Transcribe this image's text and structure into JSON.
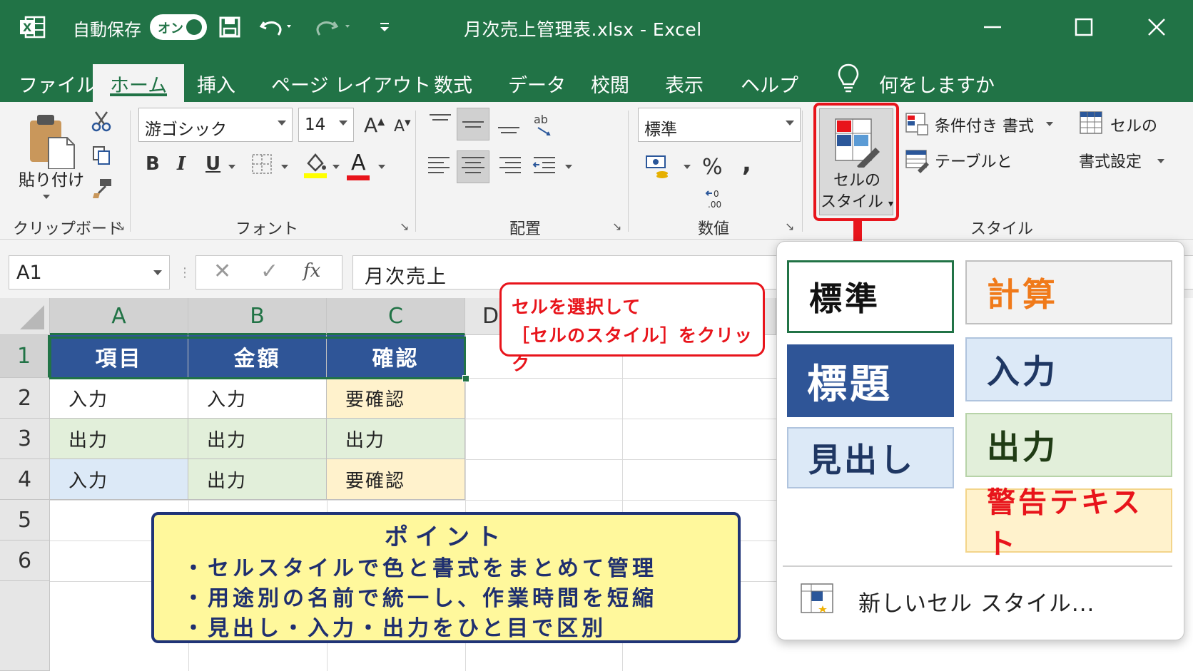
{
  "titlebar": {
    "autosave_label": "自動保存",
    "autosave_state": "オン",
    "doc_title": "月次売上管理表.xlsx  -  Excel",
    "bg_color": "#217346"
  },
  "tabs": {
    "items": [
      "ファイル",
      "ホーム",
      "挿入",
      "ページ レイアウト",
      "数式",
      "データ",
      "校閲",
      "表示",
      "ヘルプ"
    ],
    "active": "ホーム",
    "tell_me": "何をしますか"
  },
  "ribbon": {
    "clipboard": {
      "paste_label": "貼り付け",
      "group_label": "クリップボード"
    },
    "font": {
      "font_name": "游ゴシック",
      "font_size": "14",
      "grow": "A",
      "shrink": "A",
      "bold": "B",
      "italic": "I",
      "underline": "U",
      "font_color_glyph": "A",
      "group_label": "フォント"
    },
    "alignment": {
      "group_label": "配置"
    },
    "number": {
      "format": "標準",
      "percent": "%",
      "comma": ",",
      "group_label": "数値"
    },
    "styles": {
      "conditional": "条件付き 書式",
      "table": "テーブルと",
      "cell_format_1": "セルの",
      "cell_format_2": "書式設定",
      "cell_styles_1": "セルの",
      "cell_styles_2": "スタイル",
      "group_label": "スタイル"
    }
  },
  "formula_bar": {
    "name_box": "A1",
    "fx": "fx",
    "formula": "月次売上"
  },
  "sheet": {
    "columns": [
      "A",
      "B",
      "C",
      "D"
    ],
    "rows": [
      "1",
      "2",
      "3",
      "4",
      "5",
      "6"
    ],
    "header_row": [
      "項目",
      "金額",
      "確認"
    ],
    "data": [
      [
        "入力",
        "入力",
        "要確認"
      ],
      [
        "出力",
        "出力",
        "出力"
      ],
      [
        "入力",
        "出力",
        "要確認"
      ]
    ],
    "colors": {
      "header": "#2f5597",
      "input": "#dce9f7",
      "output": "#e2efda",
      "check": "#fff2cc"
    }
  },
  "callout": {
    "line1": "セルを選択して",
    "line2": "［セルのスタイル］をクリック",
    "color": "#e8141b"
  },
  "point_box": {
    "title": "ポイント",
    "items": [
      "・セルスタイルで色と書式をまとめて管理",
      "・用途別の名前で統一し、作業時間を短縮",
      "・見出し・入力・出力をひと目で区別"
    ]
  },
  "styles_menu": {
    "standard": "標準",
    "calculation": "計算",
    "title": "標題",
    "input": "入力",
    "heading": "見出し",
    "output": "出力",
    "warning": "警告テキスト",
    "new_style": "新しいセル スタイル..."
  }
}
